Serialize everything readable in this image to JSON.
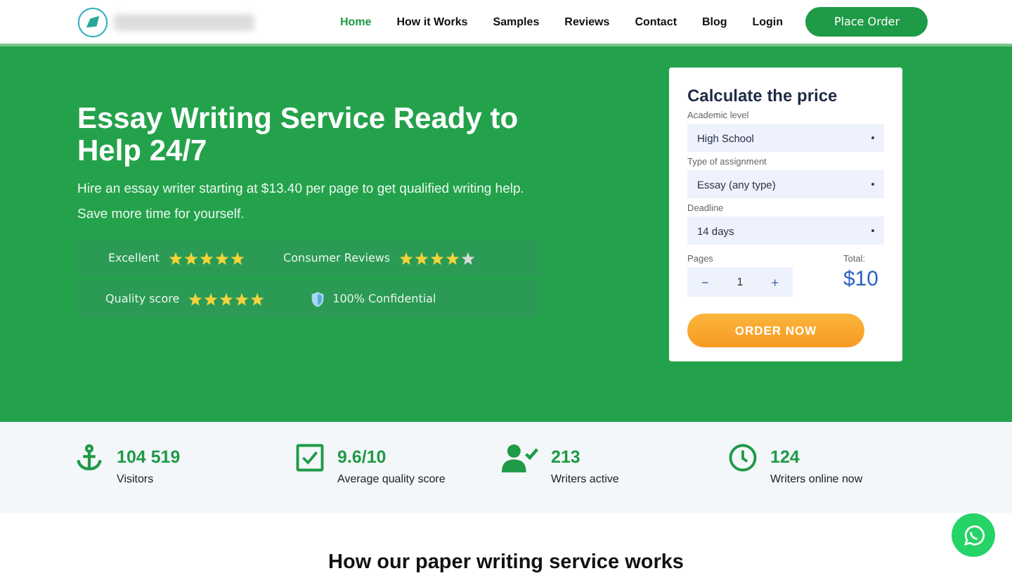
{
  "nav": {
    "items": [
      {
        "label": "Home",
        "selected": true
      },
      {
        "label": "How it Works",
        "selected": false
      },
      {
        "label": "Samples",
        "selected": false
      },
      {
        "label": "Reviews",
        "selected": false
      },
      {
        "label": "Contact",
        "selected": false
      },
      {
        "label": "Blog",
        "selected": false
      },
      {
        "label": "Login",
        "selected": false
      }
    ],
    "cta": "Place Order"
  },
  "hero": {
    "title": "Essay Writing Service Ready to Help 24/7",
    "subtitle": "Hire an essay writer starting at $13.40 per page to get qualified writing help. Save more time for yourself.",
    "ratings": [
      {
        "label": "Excellent",
        "stars": 5
      },
      {
        "label": "Consumer Reviews",
        "stars": 4
      },
      {
        "label": "Quality score",
        "stars": 5
      }
    ],
    "badge": "100% Confidential"
  },
  "calculator": {
    "title": "Calculate the price",
    "fields": [
      {
        "label": "Academic level",
        "value": "High School"
      },
      {
        "label": "Type of assignment",
        "value": "Essay (any type)"
      },
      {
        "label": "Deadline",
        "value": "14 days"
      }
    ],
    "pages_label": "Pages",
    "minus": "−",
    "pages": "1",
    "plus": "+",
    "total_label": "Total:",
    "total": "$10",
    "button": "ORDER NOW"
  },
  "stats": [
    {
      "kind": "anchor",
      "value": "104 519",
      "label": "Visitors"
    },
    {
      "kind": "check",
      "value": "9.6/10",
      "label": "Average quality score"
    },
    {
      "kind": "user",
      "value": "213",
      "label": "Writers active"
    },
    {
      "kind": "clock",
      "value": "124",
      "label": "Writers online now"
    }
  ],
  "section_title": "How our paper writing service works"
}
